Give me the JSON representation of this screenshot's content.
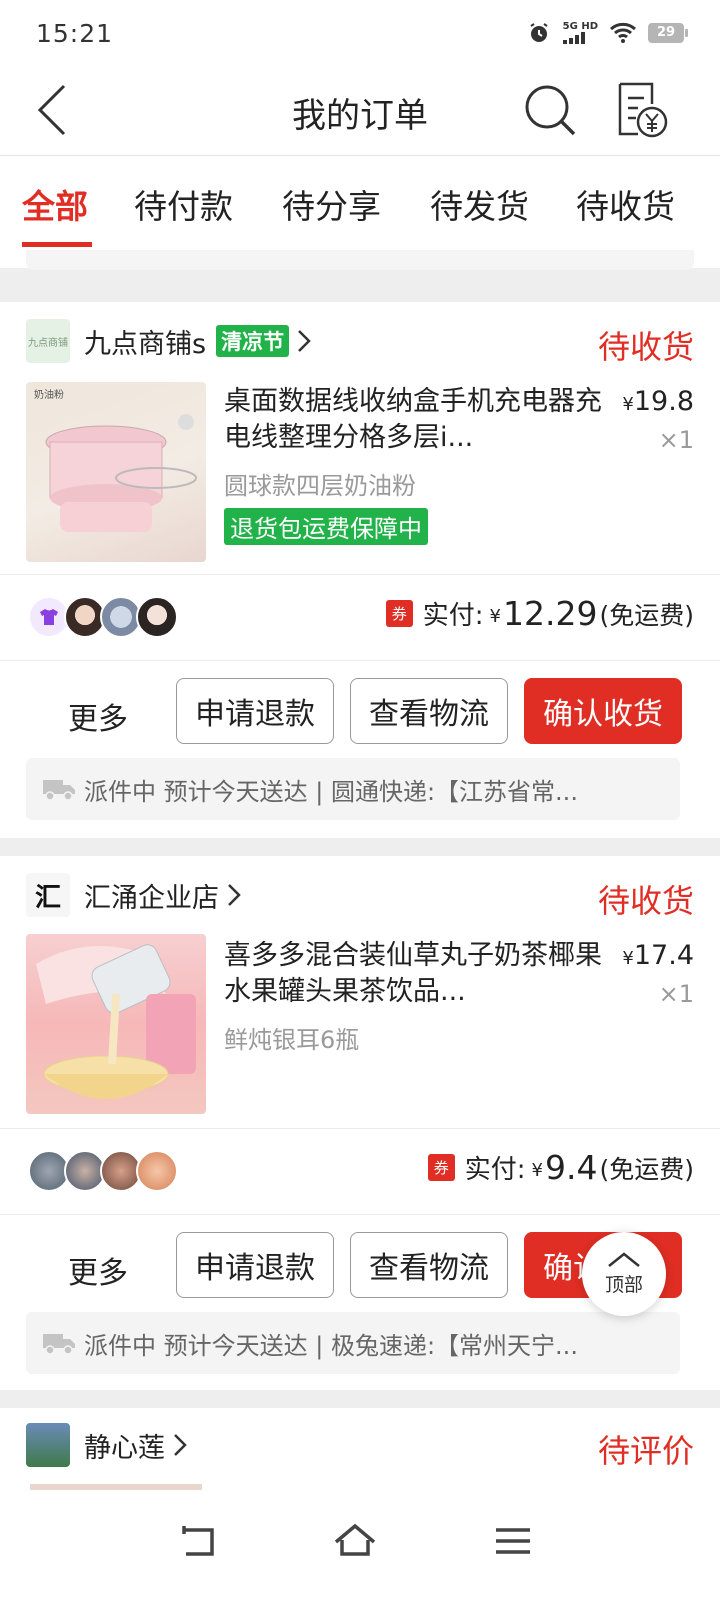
{
  "status_bar": {
    "time": "15:21",
    "network": "5G HD",
    "battery": "29"
  },
  "header": {
    "title": "我的订单"
  },
  "tabs": [
    {
      "label": "全部",
      "active": true
    },
    {
      "label": "待付款"
    },
    {
      "label": "待分享"
    },
    {
      "label": "待发货"
    },
    {
      "label": "待收货"
    }
  ],
  "orders": [
    {
      "shop_logo_text": "九点商铺",
      "shop_name": "九点商铺s",
      "shop_badge": "清凉节",
      "status": "待收货",
      "image_label": "奶油粉",
      "goods_title": "桌面数据线收纳盒手机充电器充电线整理分格多层i...",
      "price_symbol": "¥",
      "price": "19.8",
      "quantity": "×1",
      "spec": "圆球款四层奶油粉",
      "tag": "退货包运费保障中",
      "coupon": "券",
      "paid_label": "实付:",
      "paid_symbol": "¥",
      "paid_amount": "12.29",
      "paid_note": "(免运费)",
      "more": "更多",
      "btn_refund": "申请退款",
      "btn_logistics": "查看物流",
      "btn_confirm": "确认收货",
      "logistics": "派件中 预计今天送达 | 圆通快递:【江苏省常..."
    },
    {
      "shop_logo_text": "汇",
      "shop_name": "汇涌企业店",
      "status": "待收货",
      "goods_title": "喜多多混合装仙草丸子奶茶椰果水果罐头果茶饮品...",
      "price_symbol": "¥",
      "price": "17.4",
      "quantity": "×1",
      "spec": "鲜炖银耳6瓶",
      "coupon": "券",
      "paid_label": "实付:",
      "paid_symbol": "¥",
      "paid_amount": "9.4",
      "paid_note": "(免运费)",
      "more": "更多",
      "btn_refund": "申请退款",
      "btn_logistics": "查看物流",
      "btn_confirm": "确认收货",
      "logistics": "派件中 预计今天送达 | 极兔速递:【常州天宁..."
    },
    {
      "shop_name": "静心莲",
      "status": "待评价"
    }
  ],
  "fab": {
    "label": "顶部"
  },
  "colors": {
    "accent": "#e02e24",
    "green": "#21b249"
  }
}
